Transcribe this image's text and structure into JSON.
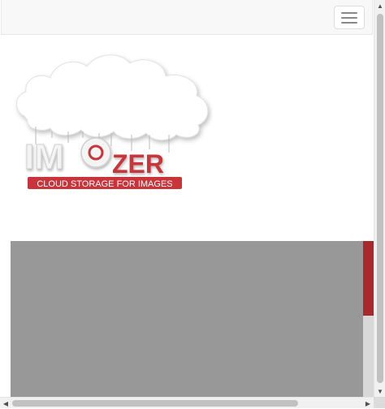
{
  "navbar": {
    "toggle_label": "Toggle navigation"
  },
  "logo": {
    "word_left": "IM",
    "word_right": "ZER",
    "tagline": "CLOUD STORAGE FOR IMAGES",
    "colors": {
      "red": "#c8343a",
      "cloud": "#ffffff",
      "letters": "#f4f4f4"
    }
  },
  "banner": {
    "background": "#989898",
    "accent": "#a8282c"
  },
  "scrollbars": {
    "up_arrow": "▲",
    "down_arrow": "▼",
    "left_arrow": "◀",
    "right_arrow": "▶"
  }
}
